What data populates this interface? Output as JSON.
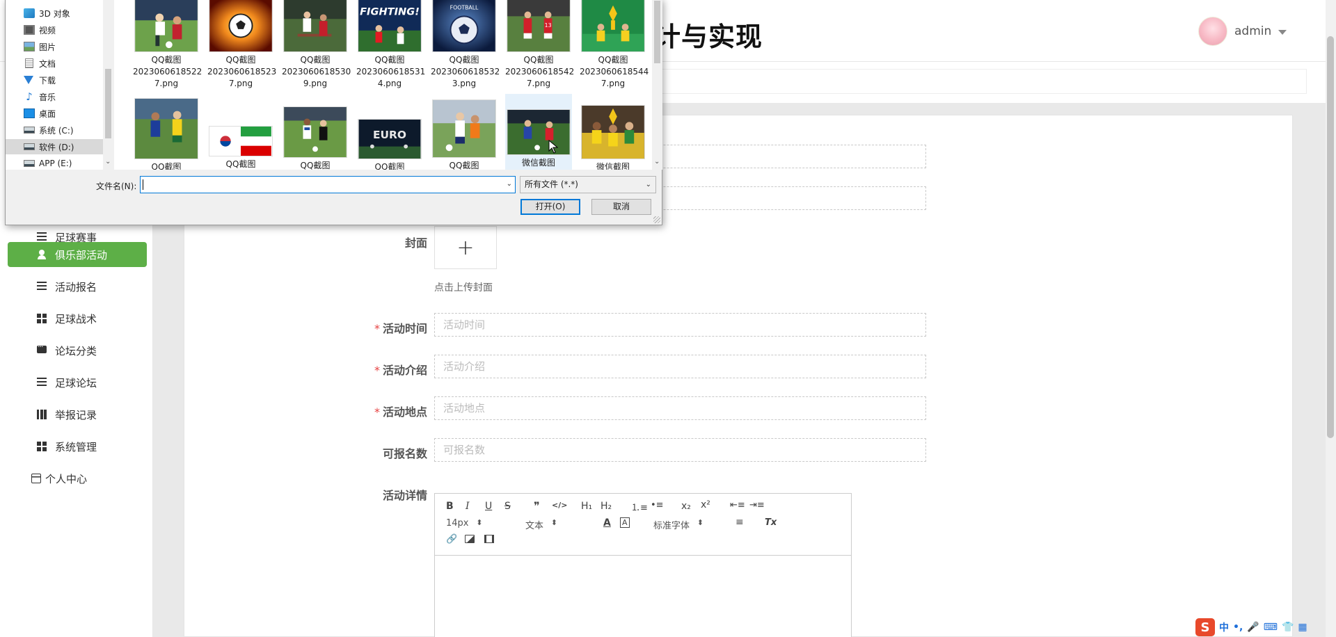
{
  "header": {
    "title": "计与实现",
    "user": "admin"
  },
  "sidebar": {
    "items": [
      {
        "label": "足球赛事"
      },
      {
        "label": "俱乐部活动"
      },
      {
        "label": "活动报名"
      },
      {
        "label": "足球战术"
      },
      {
        "label": "论坛分类"
      },
      {
        "label": "足球论坛"
      },
      {
        "label": "举报记录"
      },
      {
        "label": "系统管理"
      },
      {
        "label": "个人中心"
      }
    ]
  },
  "form": {
    "cover_label": "封面",
    "cover_plus": "+",
    "cover_hint": "点击上传封面",
    "time_label": "活动时间",
    "time_placeholder": "活动时间",
    "intro_label": "活动介绍",
    "intro_placeholder": "活动介绍",
    "place_label": "活动地点",
    "place_placeholder": "活动地点",
    "count_label": "可报名数",
    "count_placeholder": "可报名数",
    "detail_label": "活动详情",
    "required_mark": "*"
  },
  "editor": {
    "font_size": "14px",
    "heading": "文本",
    "font_family": "标准字体",
    "h1": "H₁",
    "h2": "H₂",
    "sub": "x₂",
    "sup": "x²",
    "bold": "B",
    "italic": "I",
    "underline": "U",
    "strike": "S",
    "quote": "❞",
    "code": "</>",
    "color": "A",
    "clear": "Tx"
  },
  "ime": {
    "logo": "S",
    "mode": "中",
    "punct": "•,"
  },
  "dialog": {
    "nav": [
      {
        "label": "3D 对象"
      },
      {
        "label": "视频"
      },
      {
        "label": "图片"
      },
      {
        "label": "文档"
      },
      {
        "label": "下载"
      },
      {
        "label": "音乐"
      },
      {
        "label": "桌面"
      },
      {
        "label": "系统 (C:)"
      },
      {
        "label": "软件 (D:)"
      },
      {
        "label": "APP (E:)"
      }
    ],
    "files_row1": [
      {
        "line1": "QQ截图",
        "line2": "2023060618522",
        "line3": "7.png"
      },
      {
        "line1": "QQ截图",
        "line2": "2023060618523",
        "line3": "7.png"
      },
      {
        "line1": "QQ截图",
        "line2": "2023060618530",
        "line3": "9.png"
      },
      {
        "line1": "QQ截图",
        "line2": "2023060618531",
        "line3": "4.png"
      },
      {
        "line1": "QQ截图",
        "line2": "2023060618532",
        "line3": "3.png"
      },
      {
        "line1": "QQ截图",
        "line2": "2023060618542",
        "line3": "7.png"
      },
      {
        "line1": "QQ截图",
        "line2": "2023060618544",
        "line3": "7.png"
      }
    ],
    "files_row2": [
      {
        "line1": "QQ截图"
      },
      {
        "line1": "QQ截图"
      },
      {
        "line1": "QQ截图"
      },
      {
        "line1": "QQ截图"
      },
      {
        "line1": "QQ截图"
      },
      {
        "line1": "微信截图"
      },
      {
        "line1": "微信截图"
      }
    ],
    "thumb_text_fighting": "FIGHTING!",
    "thumb_text_euro": "EURO",
    "thumb_text_football": "FOOTBALL",
    "filename_label": "文件名(N):",
    "filename_value": "",
    "filetype": "所有文件 (*.*)",
    "open_button": "打开(O)",
    "cancel_button": "取消"
  }
}
